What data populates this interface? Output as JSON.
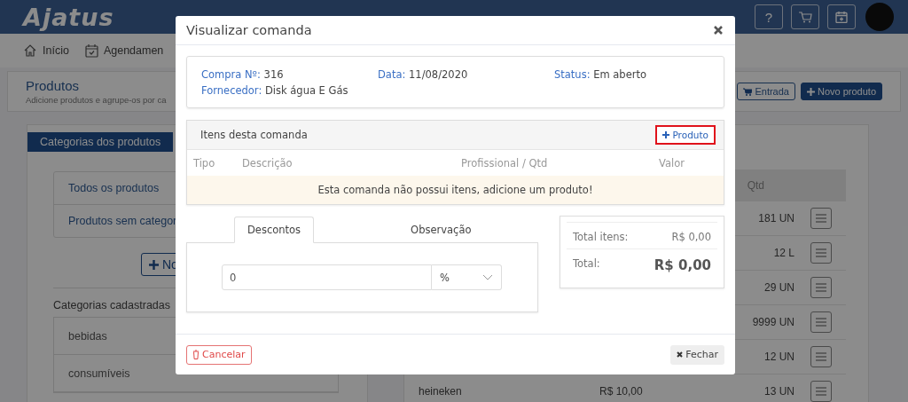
{
  "header": {
    "logo": "Ajatus",
    "help_button": "?"
  },
  "nav": [
    {
      "label": "Início",
      "kind": "home"
    },
    {
      "label": "Agendamen",
      "kind": "calendar"
    }
  ],
  "page": {
    "title": "Produtos",
    "subtitle": "Adicione produtos e agrupe-os por ca",
    "buttons": [
      {
        "label": "Entrada",
        "kind": "outline"
      },
      {
        "label": "Novo produto",
        "kind": "primary"
      }
    ]
  },
  "categories": {
    "tab": "Categorias dos produtos",
    "filters": [
      "Todos os produtos",
      "Produtos sem categor"
    ],
    "new_button": "No",
    "registered_title": "Categorias cadastradas",
    "registered": [
      "bebidas",
      "consumíveis"
    ]
  },
  "products": {
    "qtd_header": "Qtd",
    "rows": [
      {
        "qtd": "181 UN"
      },
      {
        "qtd": "12 L"
      },
      {
        "qtd": "29 UN"
      },
      {
        "qtd": "9999 UN"
      },
      {
        "qtd": "12 UN"
      },
      {
        "name": "heineken",
        "price": "R$ 10,00",
        "qtd": "13 UN"
      }
    ]
  },
  "modal": {
    "title": "Visualizar comanda",
    "info": [
      {
        "label": "Compra Nº:",
        "value": "316"
      },
      {
        "label": "Data:",
        "value": "11/08/2020"
      },
      {
        "label": "Status:",
        "value": "Em aberto"
      },
      {
        "label": "Fornecedor:",
        "value": "Disk água E Gás"
      }
    ],
    "items": {
      "title": "Itens desta comanda",
      "add_button": "Produto",
      "columns": [
        "Tipo",
        "Descrição",
        "Profissional / Qtd",
        "Valor"
      ],
      "empty_message": "Esta comanda não possui itens, adicione um produto!"
    },
    "tabs": [
      {
        "label": "Descontos",
        "selected": true
      },
      {
        "label": "Observação",
        "selected": false
      }
    ],
    "discount": {
      "value": "0",
      "unit": "%"
    },
    "totals": [
      {
        "label": "Total itens:",
        "value": "R$ 0,00",
        "kind": "subtotal"
      },
      {
        "label": "Total:",
        "value": "R$ 0,00",
        "kind": "grand"
      }
    ],
    "buttons": {
      "cancel": "Cancelar",
      "close": "Fechar"
    }
  }
}
